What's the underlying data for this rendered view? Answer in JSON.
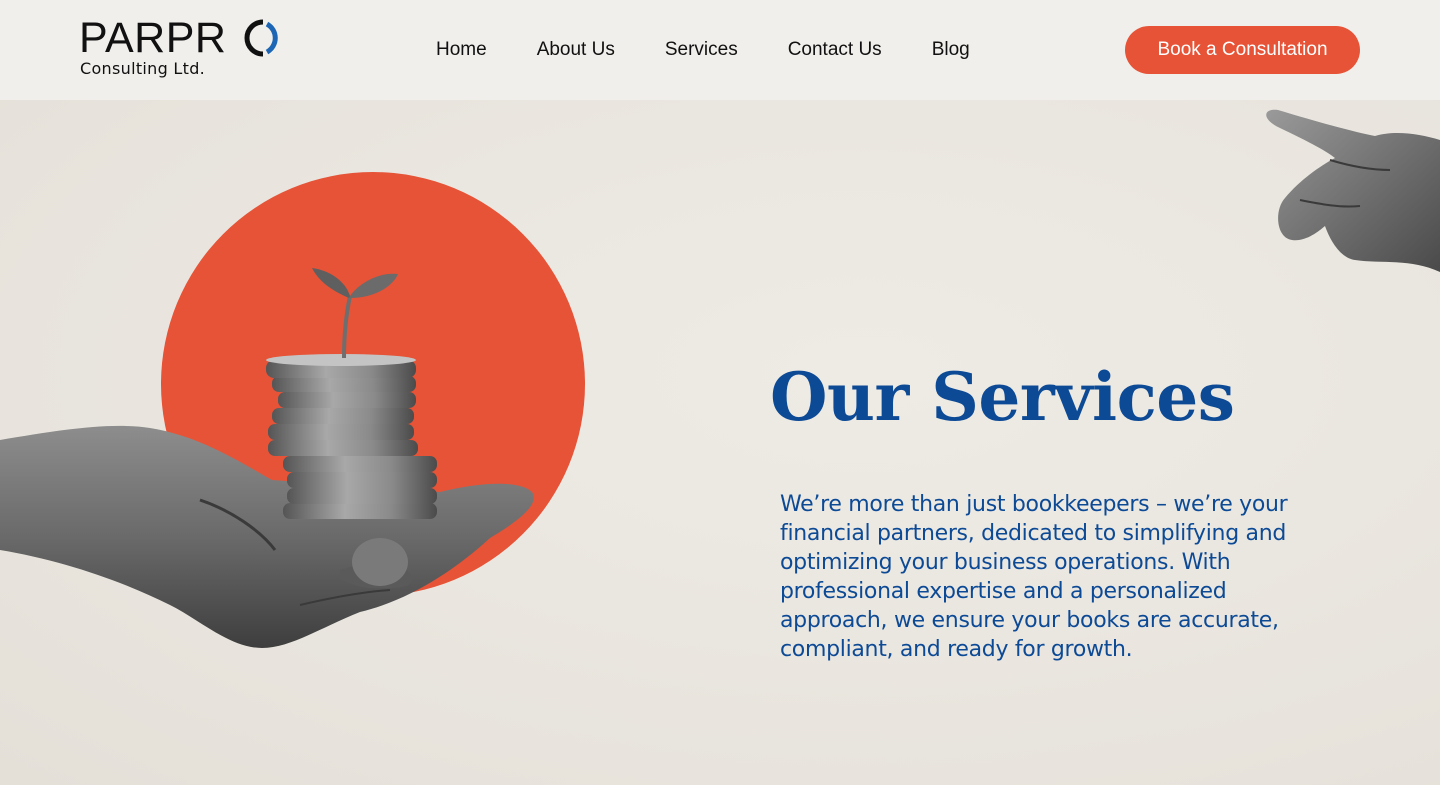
{
  "header": {
    "logo": {
      "wordmark": "PARPR",
      "subtitle": "Consulting Ltd."
    },
    "nav": [
      {
        "label": "Home"
      },
      {
        "label": "About Us"
      },
      {
        "label": "Services"
      },
      {
        "label": "Contact Us"
      },
      {
        "label": "Blog"
      }
    ],
    "cta_label": "Book a Consultation"
  },
  "hero": {
    "title": "Our Services",
    "description": "We’re more than just bookkeepers – we’re your financial partners, dedicated to simplifying and optimizing your business operations. With professional expertise and a personalized approach, we ensure your books are accurate, compliant, and ready for growth.",
    "images": {
      "left": "hand-holding-coin-stack-with-sprout",
      "right": "pointing-hand"
    }
  },
  "colors": {
    "accent": "#e65337",
    "brand_blue": "#0d4a96",
    "header_bg": "#f1efeb",
    "page_bg": "#ebe8e2",
    "logo_ring_blue": "#1c66b5"
  }
}
